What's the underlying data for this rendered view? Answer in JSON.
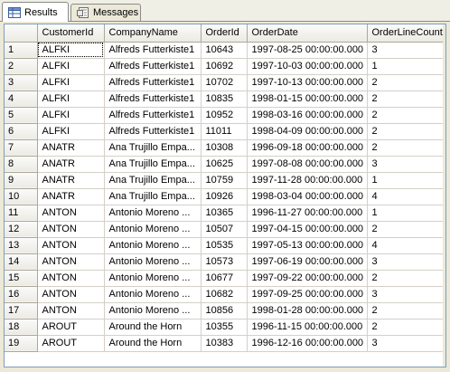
{
  "tabs": [
    {
      "label": "Results",
      "icon": "grid-icon",
      "active": true
    },
    {
      "label": "Messages",
      "icon": "messages-icon",
      "active": false
    }
  ],
  "grid": {
    "columns": [
      "CustomerId",
      "CompanyName",
      "OrderId",
      "OrderDate",
      "OrderLineCount"
    ],
    "rows": [
      {
        "n": "1",
        "CustomerId": "ALFKI",
        "CompanyName": "Alfreds Futterkiste1",
        "OrderId": "10643",
        "OrderDate": "1997-08-25 00:00:00.000",
        "OrderLineCount": "3"
      },
      {
        "n": "2",
        "CustomerId": "ALFKI",
        "CompanyName": "Alfreds Futterkiste1",
        "OrderId": "10692",
        "OrderDate": "1997-10-03 00:00:00.000",
        "OrderLineCount": "1"
      },
      {
        "n": "3",
        "CustomerId": "ALFKI",
        "CompanyName": "Alfreds Futterkiste1",
        "OrderId": "10702",
        "OrderDate": "1997-10-13 00:00:00.000",
        "OrderLineCount": "2"
      },
      {
        "n": "4",
        "CustomerId": "ALFKI",
        "CompanyName": "Alfreds Futterkiste1",
        "OrderId": "10835",
        "OrderDate": "1998-01-15 00:00:00.000",
        "OrderLineCount": "2"
      },
      {
        "n": "5",
        "CustomerId": "ALFKI",
        "CompanyName": "Alfreds Futterkiste1",
        "OrderId": "10952",
        "OrderDate": "1998-03-16 00:00:00.000",
        "OrderLineCount": "2"
      },
      {
        "n": "6",
        "CustomerId": "ALFKI",
        "CompanyName": "Alfreds Futterkiste1",
        "OrderId": "11011",
        "OrderDate": "1998-04-09 00:00:00.000",
        "OrderLineCount": "2"
      },
      {
        "n": "7",
        "CustomerId": "ANATR",
        "CompanyName": "Ana Trujillo Empa...",
        "OrderId": "10308",
        "OrderDate": "1996-09-18 00:00:00.000",
        "OrderLineCount": "2"
      },
      {
        "n": "8",
        "CustomerId": "ANATR",
        "CompanyName": "Ana Trujillo Empa...",
        "OrderId": "10625",
        "OrderDate": "1997-08-08 00:00:00.000",
        "OrderLineCount": "3"
      },
      {
        "n": "9",
        "CustomerId": "ANATR",
        "CompanyName": "Ana Trujillo Empa...",
        "OrderId": "10759",
        "OrderDate": "1997-11-28 00:00:00.000",
        "OrderLineCount": "1"
      },
      {
        "n": "10",
        "CustomerId": "ANATR",
        "CompanyName": "Ana Trujillo Empa...",
        "OrderId": "10926",
        "OrderDate": "1998-03-04 00:00:00.000",
        "OrderLineCount": "4"
      },
      {
        "n": "11",
        "CustomerId": "ANTON",
        "CompanyName": "Antonio Moreno ...",
        "OrderId": "10365",
        "OrderDate": "1996-11-27 00:00:00.000",
        "OrderLineCount": "1"
      },
      {
        "n": "12",
        "CustomerId": "ANTON",
        "CompanyName": "Antonio Moreno ...",
        "OrderId": "10507",
        "OrderDate": "1997-04-15 00:00:00.000",
        "OrderLineCount": "2"
      },
      {
        "n": "13",
        "CustomerId": "ANTON",
        "CompanyName": "Antonio Moreno ...",
        "OrderId": "10535",
        "OrderDate": "1997-05-13 00:00:00.000",
        "OrderLineCount": "4"
      },
      {
        "n": "14",
        "CustomerId": "ANTON",
        "CompanyName": "Antonio Moreno ...",
        "OrderId": "10573",
        "OrderDate": "1997-06-19 00:00:00.000",
        "OrderLineCount": "3"
      },
      {
        "n": "15",
        "CustomerId": "ANTON",
        "CompanyName": "Antonio Moreno ...",
        "OrderId": "10677",
        "OrderDate": "1997-09-22 00:00:00.000",
        "OrderLineCount": "2"
      },
      {
        "n": "16",
        "CustomerId": "ANTON",
        "CompanyName": "Antonio Moreno ...",
        "OrderId": "10682",
        "OrderDate": "1997-09-25 00:00:00.000",
        "OrderLineCount": "3"
      },
      {
        "n": "17",
        "CustomerId": "ANTON",
        "CompanyName": "Antonio Moreno ...",
        "OrderId": "10856",
        "OrderDate": "1998-01-28 00:00:00.000",
        "OrderLineCount": "2"
      },
      {
        "n": "18",
        "CustomerId": "AROUT",
        "CompanyName": "Around the Horn",
        "OrderId": "10355",
        "OrderDate": "1996-11-15 00:00:00.000",
        "OrderLineCount": "2"
      },
      {
        "n": "19",
        "CustomerId": "AROUT",
        "CompanyName": "Around the Horn",
        "OrderId": "10383",
        "OrderDate": "1996-12-16 00:00:00.000",
        "OrderLineCount": "3"
      }
    ]
  }
}
